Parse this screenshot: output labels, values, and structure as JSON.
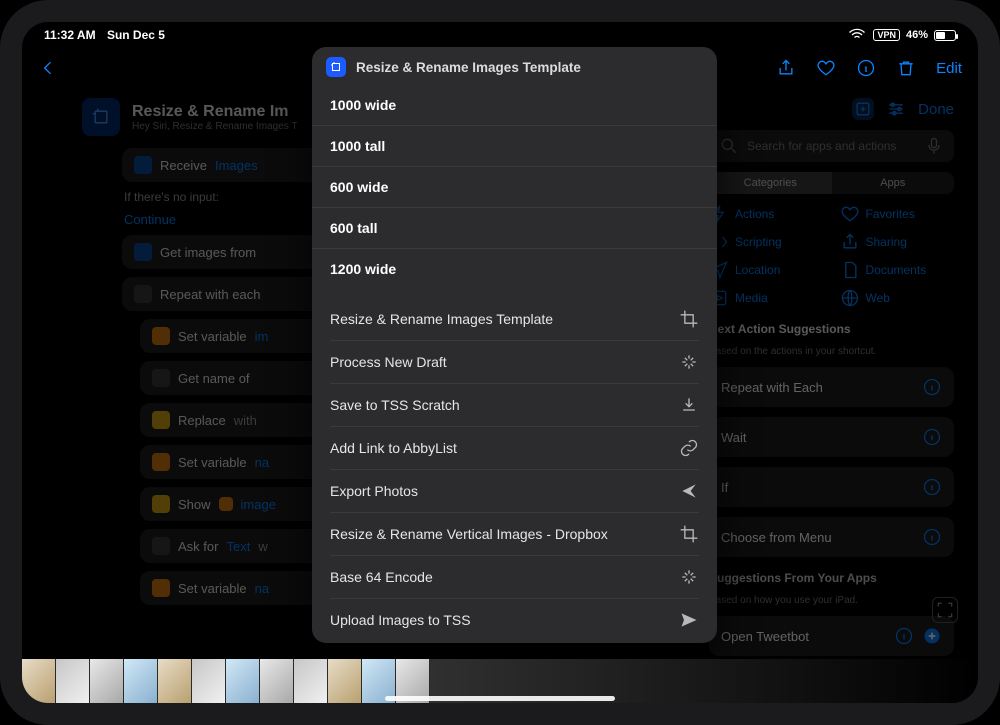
{
  "status": {
    "time": "11:32 AM",
    "date": "Sun Dec 5",
    "wifi": true,
    "vpn": "VPN",
    "battery_pct": "46%"
  },
  "toolbar": {
    "back": "Back",
    "share": "Share",
    "favorite": "Favorite",
    "info": "Info",
    "delete": "Delete",
    "edit": "Edit"
  },
  "shortcut": {
    "title": "Resize & Rename Im",
    "subtitle": "Hey Siri, Resize & Rename Images T",
    "done": "Done"
  },
  "flow": {
    "receive_label": "Receive",
    "receive_value": "Images",
    "no_input_label": "If there's no input:",
    "continue": "Continue",
    "get_images": "Get images from",
    "repeat": "Repeat with each",
    "set_var_im": "Set variable",
    "var_im": "im",
    "get_name": "Get name of",
    "replace": "Replace",
    "with": "with",
    "set_var_na": "Set variable",
    "var_na": "na",
    "show": "Show",
    "show_value": "image",
    "ask_for": "Ask for",
    "ask_type": "Text",
    "ask_w": "w",
    "set_var_na2": "Set variable",
    "var_na2": "na"
  },
  "sidebar": {
    "search_placeholder": "Search for apps and actions",
    "seg": {
      "categories": "Categories",
      "apps": "Apps"
    },
    "categories": {
      "actions": "Actions",
      "favorites": "Favorites",
      "scripting": "Scripting",
      "sharing": "Sharing",
      "location": "Location",
      "documents": "Documents",
      "media": "Media",
      "web": "Web"
    },
    "next_title": "Next Action Suggestions",
    "next_sub": "Based on the actions in your shortcut.",
    "suggestions": [
      "Repeat with Each",
      "Wait",
      "If",
      "Choose from Menu"
    ],
    "from_apps_title": "Suggestions From Your Apps",
    "from_apps_sub": "Based on how you use your iPad.",
    "tweetbot": "Open Tweetbot"
  },
  "modal": {
    "title": "Resize & Rename Images Template",
    "sizes": [
      "1000 wide",
      "1000 tall",
      "600 wide",
      "600 tall",
      "1200 wide"
    ],
    "shortcuts": [
      {
        "label": "Resize & Rename Images Template",
        "icon": "crop"
      },
      {
        "label": "Process New Draft",
        "icon": "sparkle"
      },
      {
        "label": "Save to TSS Scratch",
        "icon": "download"
      },
      {
        "label": "Add Link to AbbyList",
        "icon": "link"
      },
      {
        "label": "Export Photos",
        "icon": "share-arrow"
      },
      {
        "label": "Resize & Rename Vertical Images - Dropbox",
        "icon": "crop"
      },
      {
        "label": "Base 64 Encode",
        "icon": "sparkle"
      },
      {
        "label": "Upload Images to TSS",
        "icon": "send"
      }
    ]
  }
}
